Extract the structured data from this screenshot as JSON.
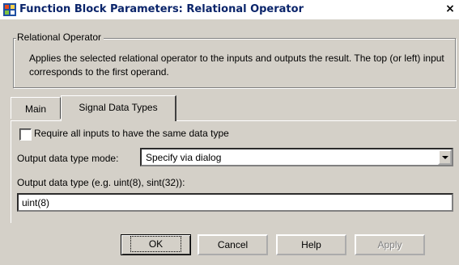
{
  "window": {
    "title": "Function Block Parameters: Relational Operator",
    "close_label": "×"
  },
  "group": {
    "title": "Relational Operator",
    "description": "Applies the selected relational operator to the inputs and outputs the result. The top (or left) input corresponds to the first operand."
  },
  "tabs": [
    {
      "label": "Main",
      "selected": false
    },
    {
      "label": "Signal Data Types",
      "selected": true
    }
  ],
  "panel": {
    "checkbox_label": "Require all inputs to have the same data type",
    "checkbox_checked": false,
    "mode_label": "Output data type mode:",
    "mode_value": "Specify via dialog",
    "type_label": "Output data type (e.g. uint(8), sint(32)):",
    "type_value": "uint(8)"
  },
  "buttons": {
    "ok": "OK",
    "cancel": "Cancel",
    "help": "Help",
    "apply": "Apply"
  }
}
